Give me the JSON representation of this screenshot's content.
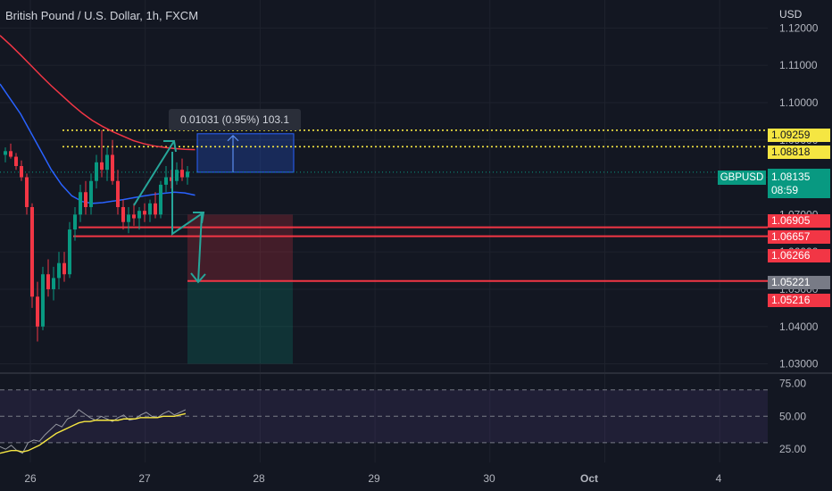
{
  "header": {
    "title": "British Pound / U.S. Dollar, 1h, FXCM",
    "currency": "USD"
  },
  "chart_data": {
    "type": "candlestick",
    "price_axis": {
      "ylim": [
        1.0275,
        1.1275
      ],
      "ticks": [
        "1.12000",
        "1.11000",
        "1.10000",
        "1.09000",
        "1.08000",
        "1.07000",
        "1.06000",
        "1.05000",
        "1.04000",
        "1.03000"
      ]
    },
    "time_axis": {
      "labels": [
        "26",
        "27",
        "28",
        "29",
        "30",
        "Oct",
        "4"
      ],
      "day_positions": [
        0,
        1,
        2,
        3,
        4,
        5,
        6
      ]
    },
    "symbol": "GBPUSD",
    "last_price": "1.08135",
    "countdown": "08:59",
    "price_tags": [
      {
        "value": "1.09259",
        "y": 1.09259,
        "bg": "#f5e642",
        "fg": "#131722"
      },
      {
        "value": "1.08818",
        "y": 1.08818,
        "bg": "#f5e642",
        "fg": "#131722"
      },
      {
        "value": "1.06905",
        "y": 1.06905,
        "bg": "#f23645",
        "fg": "#ffffff"
      },
      {
        "value": "1.06657",
        "y": 1.06657,
        "bg": "#f23645",
        "fg": "#ffffff"
      },
      {
        "value": "1.06266",
        "y": 1.06266,
        "bg": "#f23645",
        "fg": "#ffffff"
      },
      {
        "value": "1.05221",
        "y": 1.05221,
        "bg": "#787b86",
        "fg": "#ffffff"
      },
      {
        "value": "1.05216",
        "y": 1.05216,
        "bg": "#f23645",
        "fg": "#ffffff"
      }
    ],
    "horizontal_levels": {
      "dotted_yellow": [
        1.09259,
        1.08818
      ],
      "red": [
        1.06657,
        1.0642,
        1.05221
      ]
    },
    "measure": {
      "label": "0.01031 (0.95%) 103.1",
      "from": 1.08135,
      "to": 1.09166
    },
    "position_box": {
      "entry": 1.06905,
      "target": 1.03
    },
    "candles": [
      [
        1.086,
        1.088,
        1.084,
        1.087
      ],
      [
        1.087,
        1.089,
        1.085,
        1.0855
      ],
      [
        1.0855,
        1.0865,
        1.082,
        1.083
      ],
      [
        1.083,
        1.0845,
        1.079,
        1.08
      ],
      [
        1.08,
        1.081,
        1.07,
        1.072
      ],
      [
        1.072,
        1.073,
        1.045,
        1.048
      ],
      [
        1.048,
        1.052,
        1.036,
        1.04
      ],
      [
        1.04,
        1.056,
        1.039,
        1.054
      ],
      [
        1.054,
        1.058,
        1.048,
        1.05
      ],
      [
        1.05,
        1.056,
        1.047,
        1.053
      ],
      [
        1.053,
        1.06,
        1.05,
        1.057
      ],
      [
        1.057,
        1.06,
        1.052,
        1.054
      ],
      [
        1.054,
        1.068,
        1.053,
        1.066
      ],
      [
        1.066,
        1.072,
        1.063,
        1.07
      ],
      [
        1.07,
        1.078,
        1.068,
        1.076
      ],
      [
        1.076,
        1.079,
        1.07,
        1.072
      ],
      [
        1.072,
        1.081,
        1.07,
        1.079
      ],
      [
        1.079,
        1.086,
        1.077,
        1.084
      ],
      [
        1.084,
        1.0926,
        1.08,
        1.082
      ],
      [
        1.082,
        1.088,
        1.079,
        1.086
      ],
      [
        1.086,
        1.09,
        1.078,
        1.079
      ],
      [
        1.079,
        1.082,
        1.07,
        1.072
      ],
      [
        1.072,
        1.074,
        1.066,
        1.068
      ],
      [
        1.068,
        1.072,
        1.065,
        1.07
      ],
      [
        1.07,
        1.073,
        1.067,
        1.069
      ],
      [
        1.069,
        1.072,
        1.066,
        1.071
      ],
      [
        1.071,
        1.073,
        1.068,
        1.07
      ],
      [
        1.07,
        1.074,
        1.068,
        1.073
      ],
      [
        1.073,
        1.076,
        1.069,
        1.07
      ],
      [
        1.07,
        1.079,
        1.069,
        1.078
      ],
      [
        1.078,
        1.083,
        1.076,
        1.08
      ],
      [
        1.08,
        1.082,
        1.077,
        1.079
      ],
      [
        1.079,
        1.084,
        1.078,
        1.082
      ],
      [
        1.082,
        1.085,
        1.079,
        1.08
      ],
      [
        1.08,
        1.083,
        1.078,
        1.0815
      ]
    ],
    "ma_red": [
      1.118,
      1.1155,
      1.1128,
      1.11,
      1.1072,
      1.1045,
      1.102,
      1.0995,
      1.0972,
      1.0952,
      1.0936,
      1.0922,
      1.091,
      1.0898,
      1.089,
      1.0884,
      1.088,
      1.0877,
      1.0875,
      1.0874
    ],
    "ma_blue": [
      1.105,
      1.101,
      1.097,
      1.092,
      1.087,
      1.082,
      1.078,
      1.075,
      1.0735,
      1.073,
      1.0732,
      1.0736,
      1.074,
      1.0745,
      1.075,
      1.0754,
      1.0757,
      1.076,
      1.0758,
      1.0752
    ],
    "rsi": {
      "levels": [
        "75.00",
        "50.00",
        "25.00"
      ],
      "ylim": [
        15,
        80
      ],
      "upper": 70,
      "mid": 50,
      "lower": 30,
      "rsi_values": [
        27,
        25,
        28,
        24,
        22,
        30,
        32,
        31,
        36,
        40,
        44,
        42,
        48,
        50,
        55,
        52,
        49,
        47,
        50,
        48,
        46,
        49,
        51,
        47,
        48,
        51,
        53,
        50,
        49,
        52,
        54,
        51,
        53,
        55
      ],
      "signal_values": [
        22,
        23,
        24,
        24,
        23,
        24,
        26,
        28,
        31,
        34,
        37,
        39,
        41,
        43,
        45,
        46,
        46,
        47,
        47,
        47,
        47,
        47,
        48,
        48,
        48,
        49,
        49,
        49,
        49,
        50,
        50,
        50,
        51,
        52
      ]
    }
  }
}
